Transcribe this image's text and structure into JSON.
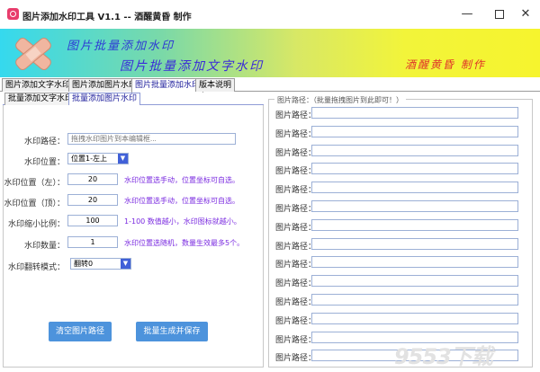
{
  "window": {
    "title": "图片添加水印工具 V1.1 -- 酒醒黄昏 制作",
    "minimize_glyph": "—",
    "close_glyph": "✕"
  },
  "banner": {
    "line1": "图片批量添加水印",
    "line2": "图片批量添加文字水印",
    "author": "酒醒黄昏 制作",
    "icon": "bandage-x-icon"
  },
  "main_tabs": [
    "图片添加文字水印",
    "图片添加图片水印",
    "图片批量添加水印",
    "版本说明"
  ],
  "main_tab_active": "图片批量添加水印",
  "sub_tabs": [
    "批量添加文字水印",
    "批量添加图片水印"
  ],
  "sub_tab_active": "批量添加图片水印",
  "form": {
    "watermark_path": {
      "label": "水印路径：",
      "placeholder": "拖拽水印图片到本编辑框..."
    },
    "position": {
      "label": "水印位置：",
      "value": "位置1-左上"
    },
    "pos_left": {
      "label": "水印位置（左）：",
      "value": "20",
      "hint": "水印位置选手动，位置坐标可自选。"
    },
    "pos_top": {
      "label": "水印位置（顶）：",
      "value": "20",
      "hint": "水印位置选手动，位置坐标可自选。"
    },
    "scale": {
      "label": "水印缩小比例：",
      "value": "100",
      "hint": "1-100 数值越小，水印图标就越小。"
    },
    "count": {
      "label": "水印数量：",
      "value": "1",
      "hint": "水印位置选随机，数量生效最多5个。"
    },
    "flip": {
      "label": "水印翻转模式：",
      "value": "翻转0"
    }
  },
  "buttons": {
    "clear": "清空图片路径",
    "generate": "批量生成并保存"
  },
  "right": {
    "legend": "图片路径：（批量拖拽图片到此即可！）",
    "path_label": "图片路径：",
    "rows": 14
  },
  "watermark_text": "9553下载",
  "colors": {
    "hint": "#7a2ae0",
    "button": "#4d93dc",
    "active_tab_text": "#1a1a9a"
  }
}
